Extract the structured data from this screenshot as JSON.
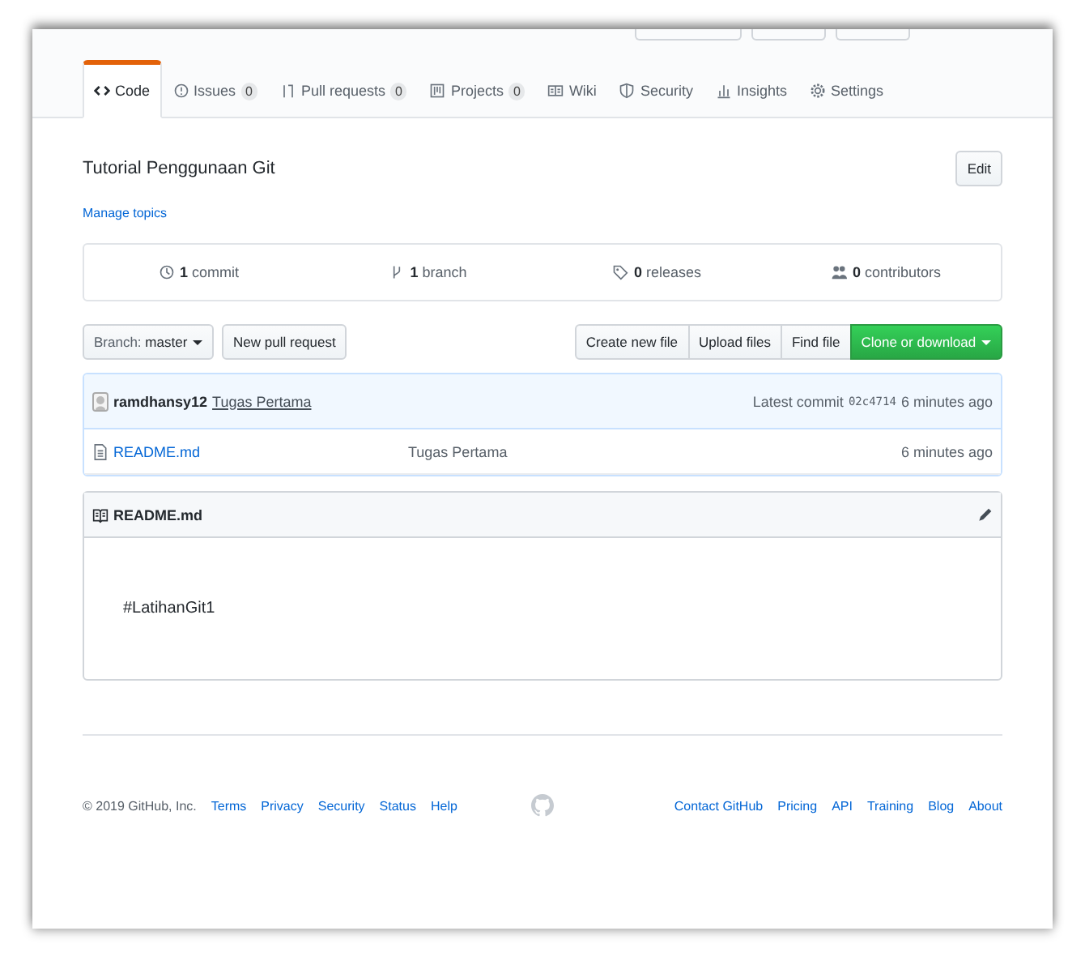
{
  "tabs": [
    {
      "label": "Code",
      "selected": true
    },
    {
      "label": "Issues",
      "count": "0",
      "selected": false
    },
    {
      "label": "Pull requests",
      "count": "0",
      "selected": false
    },
    {
      "label": "Projects",
      "count": "0",
      "selected": false
    },
    {
      "label": "Wiki",
      "selected": false
    },
    {
      "label": "Security",
      "selected": false
    },
    {
      "label": "Insights",
      "selected": false
    },
    {
      "label": "Settings",
      "selected": false
    }
  ],
  "description": "Tutorial Penggunaan Git",
  "edit_button": "Edit",
  "manage_topics": "Manage topics",
  "stats": [
    {
      "count": "1",
      "label": "commit"
    },
    {
      "count": "1",
      "label": "branch"
    },
    {
      "count": "0",
      "label": "releases"
    },
    {
      "count": "0",
      "label": "contributors"
    }
  ],
  "branch": {
    "label": "Branch:",
    "value": "master"
  },
  "new_pull_request": "New pull request",
  "file_buttons": [
    "Create new file",
    "Upload files",
    "Find file"
  ],
  "clone_button": "Clone or download",
  "latest_commit": {
    "author": "ramdhansy12",
    "message": "Tugas Pertama",
    "label": "Latest commit",
    "sha": "02c4714",
    "time": "6 minutes ago"
  },
  "files": [
    {
      "name": "README.md",
      "message": "Tugas Pertama",
      "time": "6 minutes ago"
    }
  ],
  "readme": {
    "title": "README.md",
    "content": "#LatihanGit1"
  },
  "footer": {
    "copyright": "© 2019 GitHub, Inc.",
    "left_links": [
      "Terms",
      "Privacy",
      "Security",
      "Status",
      "Help"
    ],
    "right_links": [
      "Contact GitHub",
      "Pricing",
      "API",
      "Training",
      "Blog",
      "About"
    ]
  }
}
